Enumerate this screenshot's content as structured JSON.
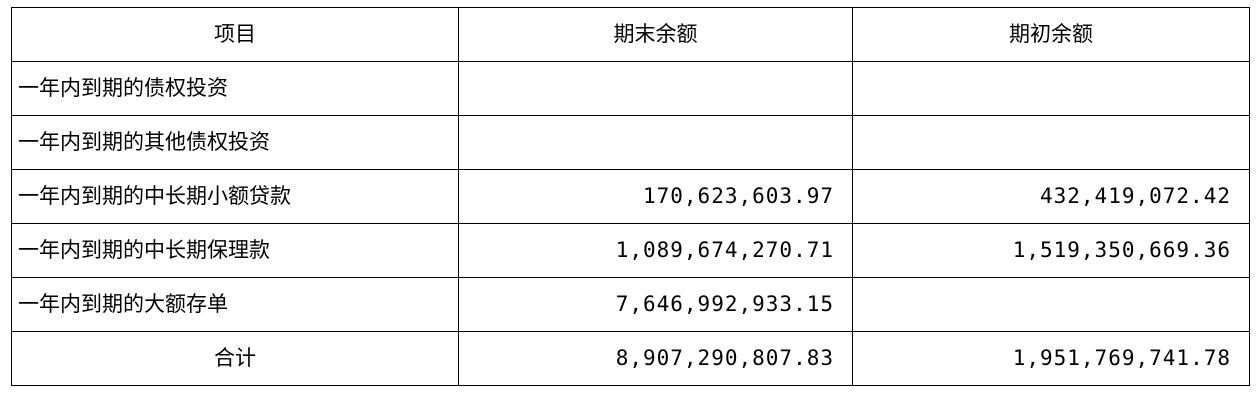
{
  "table": {
    "headers": [
      "项目",
      "期末余额",
      "期初余额"
    ],
    "rows": [
      {
        "item": "一年内到期的债权投资",
        "end": "",
        "begin": ""
      },
      {
        "item": "一年内到期的其他债权投资",
        "end": "",
        "begin": ""
      },
      {
        "item": "一年内到期的中长期小额贷款",
        "end": "170,623,603.97",
        "begin": "432,419,072.42"
      },
      {
        "item": "一年内到期的中长期保理款",
        "end": "1,089,674,270.71",
        "begin": "1,519,350,669.36"
      },
      {
        "item": "一年内到期的大额存单",
        "end": "7,646,992,933.15",
        "begin": ""
      }
    ],
    "total": {
      "item": "合计",
      "end": "8,907,290,807.83",
      "begin": "1,951,769,741.78"
    }
  }
}
